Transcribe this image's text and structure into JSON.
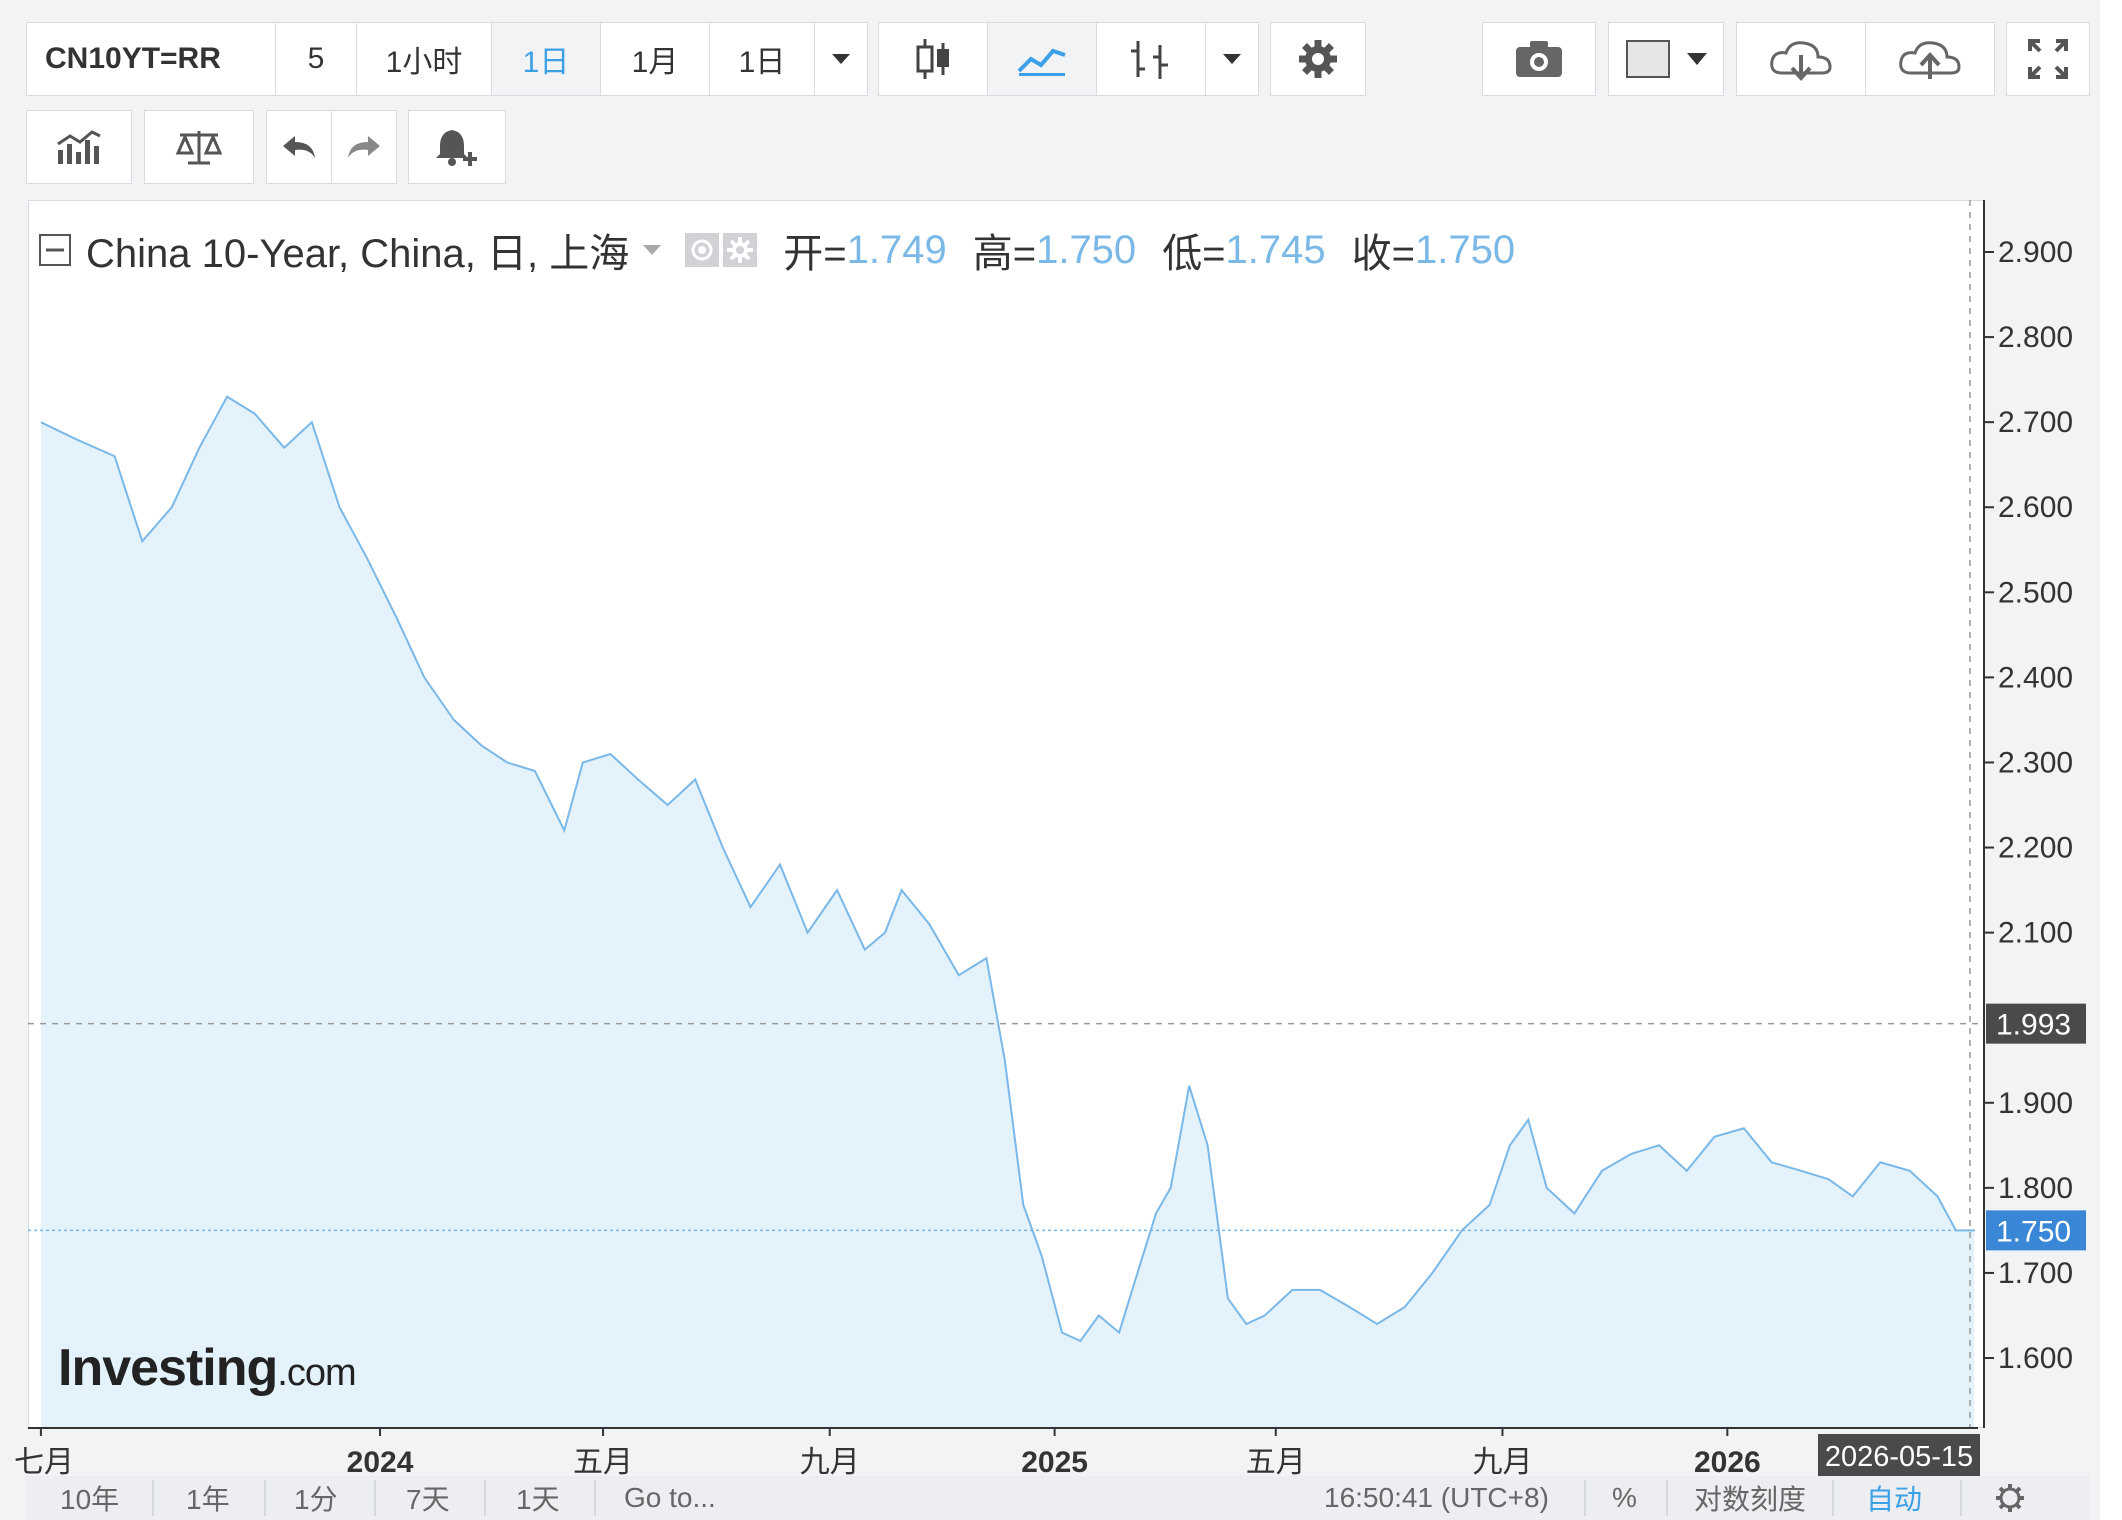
{
  "toolbar": {
    "symbol": "CN10YT=RR",
    "intervals": [
      "5",
      "1小时",
      "1日",
      "1月",
      "1日"
    ],
    "active_interval": "1日"
  },
  "legend": {
    "title": "China 10-Year, China, 日, 上海",
    "open_label": "开=",
    "open": "1.749",
    "high_label": "高=",
    "high": "1.750",
    "low_label": "低=",
    "low": "1.745",
    "close_label": "收=",
    "close": "1.750"
  },
  "logo": {
    "main": "Investing",
    "suffix": ".com"
  },
  "bottom": {
    "ranges": [
      "10年",
      "1年",
      "1分",
      "7天",
      "1天"
    ],
    "goto": "Go to...",
    "time": "16:50:41 (UTC+8)",
    "percent": "%",
    "log": "对数刻度",
    "auto": "自动"
  },
  "colors": {
    "line": "#7ab8e8",
    "area": "#e3f2fb",
    "accent": "#3ba0e6",
    "last_tag": "#3a87d8",
    "crosshair_tag": "#4a4a4a"
  },
  "chart_data": {
    "type": "area",
    "title": "China 10-Year, China, 日, 上海",
    "yticks": [
      "2.900",
      "2.800",
      "2.700",
      "2.600",
      "2.500",
      "2.400",
      "2.300",
      "2.200",
      "2.100",
      "1.900",
      "1.800",
      "1.700",
      "1.600"
    ],
    "ylim": [
      1.5,
      2.95
    ],
    "xticks": [
      {
        "label": "七月",
        "date": "2023-07-01"
      },
      {
        "label": "2024",
        "date": "2024-01-01"
      },
      {
        "label": "五月",
        "date": "2024-05-01"
      },
      {
        "label": "九月",
        "date": "2024-09-01"
      },
      {
        "label": "2025",
        "date": "2025-01-01"
      },
      {
        "label": "五月",
        "date": "2025-05-01"
      },
      {
        "label": "九月",
        "date": "2025-09-01"
      },
      {
        "label": "2026",
        "date": "2026-01-01"
      }
    ],
    "last_value": "1.750",
    "crosshair_value": "1.993",
    "crosshair_date": "2026-05-15",
    "grid": false,
    "series": [
      {
        "x": [
          "2023-07-01",
          "2023-07-20",
          "2023-08-10",
          "2023-08-25",
          "2023-09-10",
          "2023-09-25",
          "2023-10-10",
          "2023-10-25",
          "2023-11-10",
          "2023-11-25",
          "2023-12-10",
          "2023-12-25",
          "2024-01-10",
          "2024-01-25",
          "2024-02-10",
          "2024-02-25",
          "2024-03-10",
          "2024-03-25",
          "2024-04-10",
          "2024-04-20",
          "2024-05-05",
          "2024-05-20",
          "2024-06-05",
          "2024-06-20",
          "2024-07-05",
          "2024-07-20",
          "2024-08-05",
          "2024-08-20",
          "2024-09-05",
          "2024-09-20",
          "2024-10-01",
          "2024-10-10",
          "2024-10-25",
          "2024-11-10",
          "2024-11-25",
          "2024-12-05",
          "2024-12-15",
          "2024-12-25",
          "2025-01-05",
          "2025-01-15",
          "2025-01-25",
          "2025-02-05",
          "2025-02-15",
          "2025-02-25",
          "2025-03-05",
          "2025-03-15",
          "2025-03-25",
          "2025-04-05",
          "2025-04-15",
          "2025-04-25",
          "2025-05-10",
          "2025-05-25",
          "2025-06-10",
          "2025-06-25",
          "2025-07-10",
          "2025-07-25",
          "2025-08-10",
          "2025-08-25",
          "2025-09-05",
          "2025-09-15",
          "2025-09-25",
          "2025-10-10",
          "2025-10-25",
          "2025-11-10",
          "2025-11-25",
          "2025-12-10",
          "2025-12-25",
          "2026-01-10",
          "2026-01-25",
          "2026-02-10",
          "2026-02-25",
          "2026-03-10",
          "2026-03-25",
          "2026-04-10",
          "2026-04-25",
          "2026-05-05",
          "2026-05-15"
        ],
        "values": [
          2.7,
          2.68,
          2.66,
          2.56,
          2.6,
          2.67,
          2.73,
          2.71,
          2.67,
          2.7,
          2.6,
          2.54,
          2.47,
          2.4,
          2.35,
          2.32,
          2.3,
          2.29,
          2.22,
          2.3,
          2.31,
          2.28,
          2.25,
          2.28,
          2.2,
          2.13,
          2.18,
          2.1,
          2.15,
          2.08,
          2.1,
          2.15,
          2.11,
          2.05,
          2.07,
          1.95,
          1.78,
          1.72,
          1.63,
          1.62,
          1.65,
          1.63,
          1.7,
          1.77,
          1.8,
          1.92,
          1.85,
          1.67,
          1.64,
          1.65,
          1.68,
          1.68,
          1.66,
          1.64,
          1.66,
          1.7,
          1.75,
          1.78,
          1.85,
          1.88,
          1.8,
          1.77,
          1.82,
          1.84,
          1.85,
          1.82,
          1.86,
          1.87,
          1.83,
          1.82,
          1.81,
          1.79,
          1.83,
          1.82,
          1.79,
          1.75,
          1.75
        ]
      }
    ]
  }
}
